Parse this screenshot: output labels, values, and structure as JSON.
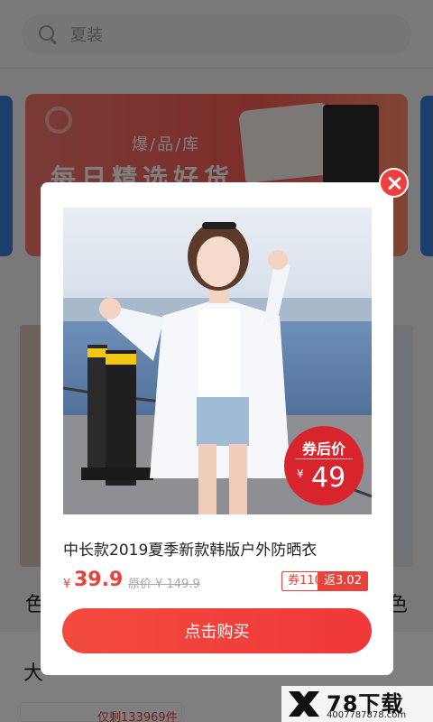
{
  "search": {
    "placeholder": "夏装"
  },
  "banner": {
    "subtitle": "爆/品/库",
    "title": "每日精选好货"
  },
  "background": {
    "left_text": "色",
    "right_text": "色",
    "section_text": "大",
    "remaining": "仅剩133969件"
  },
  "modal": {
    "badge": {
      "label": "券后价",
      "currency": "¥",
      "amount": "49"
    },
    "product_title": "中长款2019夏季新款韩版户外防晒衣",
    "price_currency": "¥",
    "price": "39.9",
    "original_price": "原价 ¥ 149.9",
    "coupon": "券110",
    "rebate": "返3.02",
    "buy_button": "点击购买"
  },
  "watermark": {
    "title": "78下载",
    "phone": "4007787878.com"
  },
  "colors": {
    "accent": "#e8433a",
    "badge": "#d8242c",
    "close": "#f03e3e"
  },
  "icons": {
    "search": "search-icon",
    "close": "close-icon",
    "logo": "watermark-logo"
  }
}
